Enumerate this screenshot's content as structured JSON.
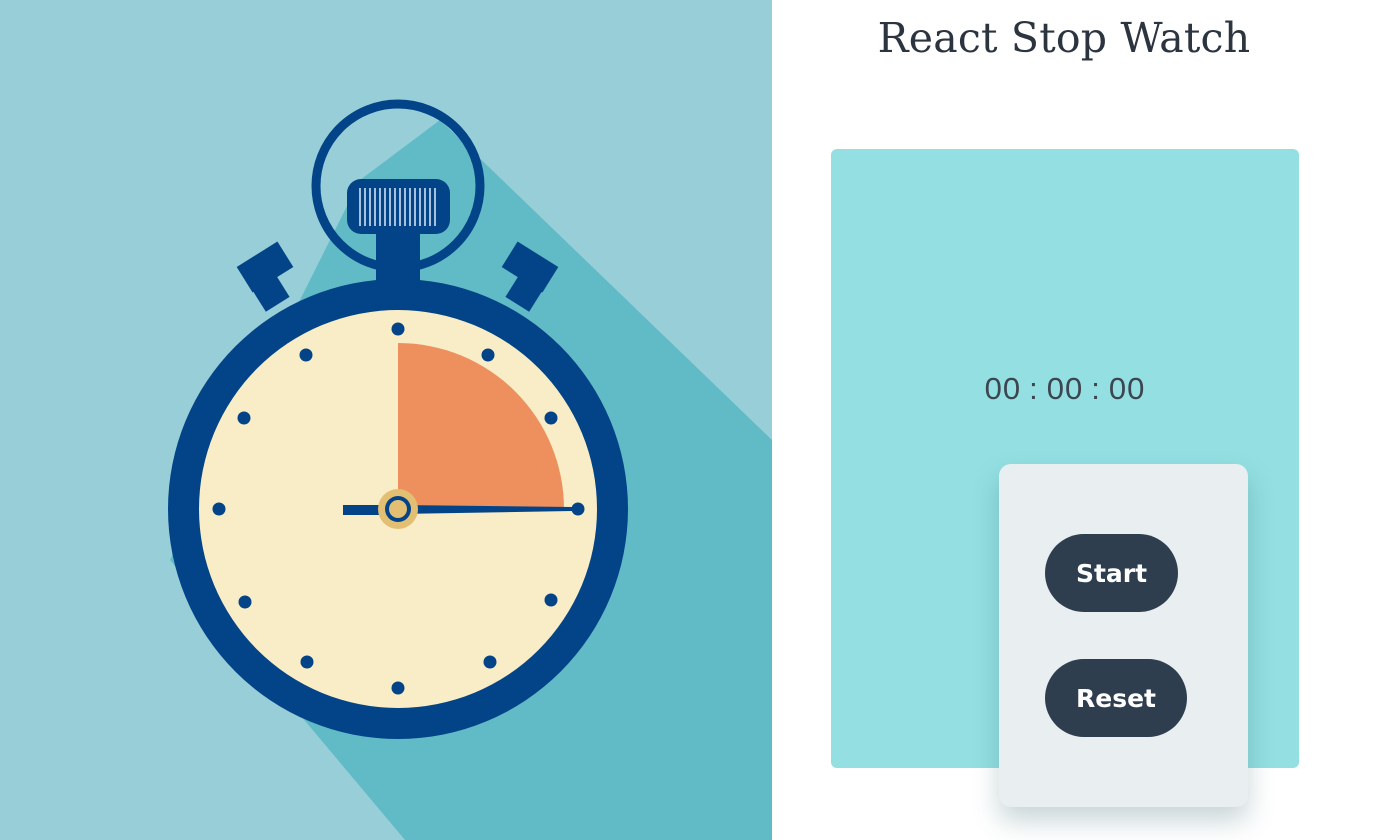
{
  "header": {
    "title": "React Stop Watch"
  },
  "stopwatch": {
    "time": {
      "hours": "00",
      "minutes": "00",
      "seconds": "00",
      "separator": ":"
    },
    "buttons": {
      "start_label": "Start",
      "reset_label": "Reset"
    }
  },
  "illustration": {
    "subject": "stopwatch-icon"
  },
  "colors": {
    "illustration_background": "#98ced8",
    "illustration_shadow": "#61bbc6",
    "watch_body": "#034488",
    "watch_face": "#f8edc6",
    "elapsed_wedge": "#ee8f5e",
    "card_background": "#93dfe2",
    "button_panel": "#e9eff0",
    "button": "#2e3e4f",
    "title_text": "#2c3440"
  }
}
